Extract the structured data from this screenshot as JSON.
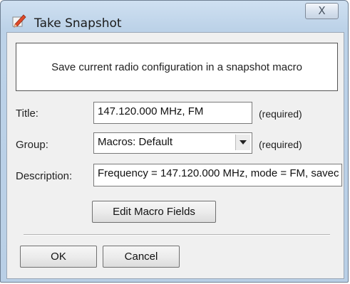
{
  "window": {
    "title": "Take Snapshot",
    "close_glyph": "X"
  },
  "banner": {
    "text": "Save current radio configuration in a snapshot macro"
  },
  "form": {
    "title": {
      "label": "Title:",
      "value": "147.120.000 MHz, FM",
      "hint": "(required)"
    },
    "group": {
      "label": "Group:",
      "value": "Macros: Default",
      "hint": "(required)"
    },
    "description": {
      "label": "Description:",
      "value": "Frequency = 147.120.000 MHz, mode = FM, savec"
    }
  },
  "buttons": {
    "edit_macro_fields": "Edit Macro Fields",
    "ok": "OK",
    "cancel": "Cancel"
  },
  "icons": {
    "title": "snapshot-pencil-icon",
    "dropdown": "chevron-down-icon"
  }
}
